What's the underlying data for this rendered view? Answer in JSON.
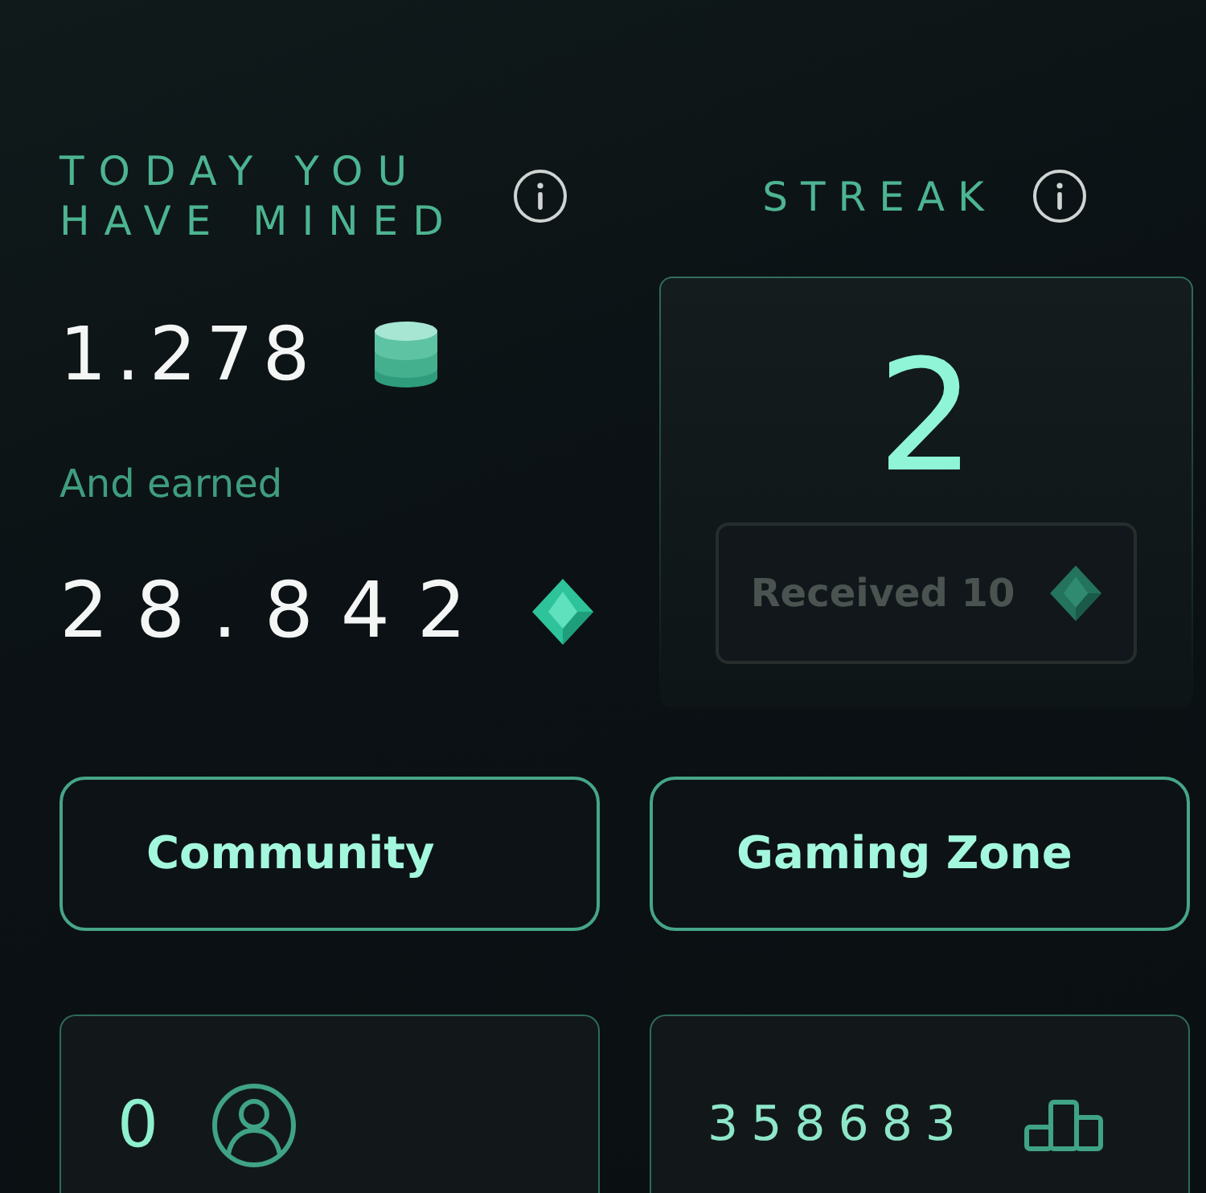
{
  "mined": {
    "title": "TODAY YOU HAVE MINED",
    "amount": "1.278",
    "earned_label": "And earned",
    "earned_amount": "28.842"
  },
  "streak": {
    "title": "STREAK",
    "count": "2",
    "reward": {
      "label": "Received 10",
      "disabled": true
    }
  },
  "buttons": [
    {
      "label": "Community"
    },
    {
      "label": "Gaming Zone"
    }
  ],
  "cards": [
    {
      "kind": "profile",
      "value": "0"
    },
    {
      "kind": "rank",
      "value": "358683"
    }
  ]
}
